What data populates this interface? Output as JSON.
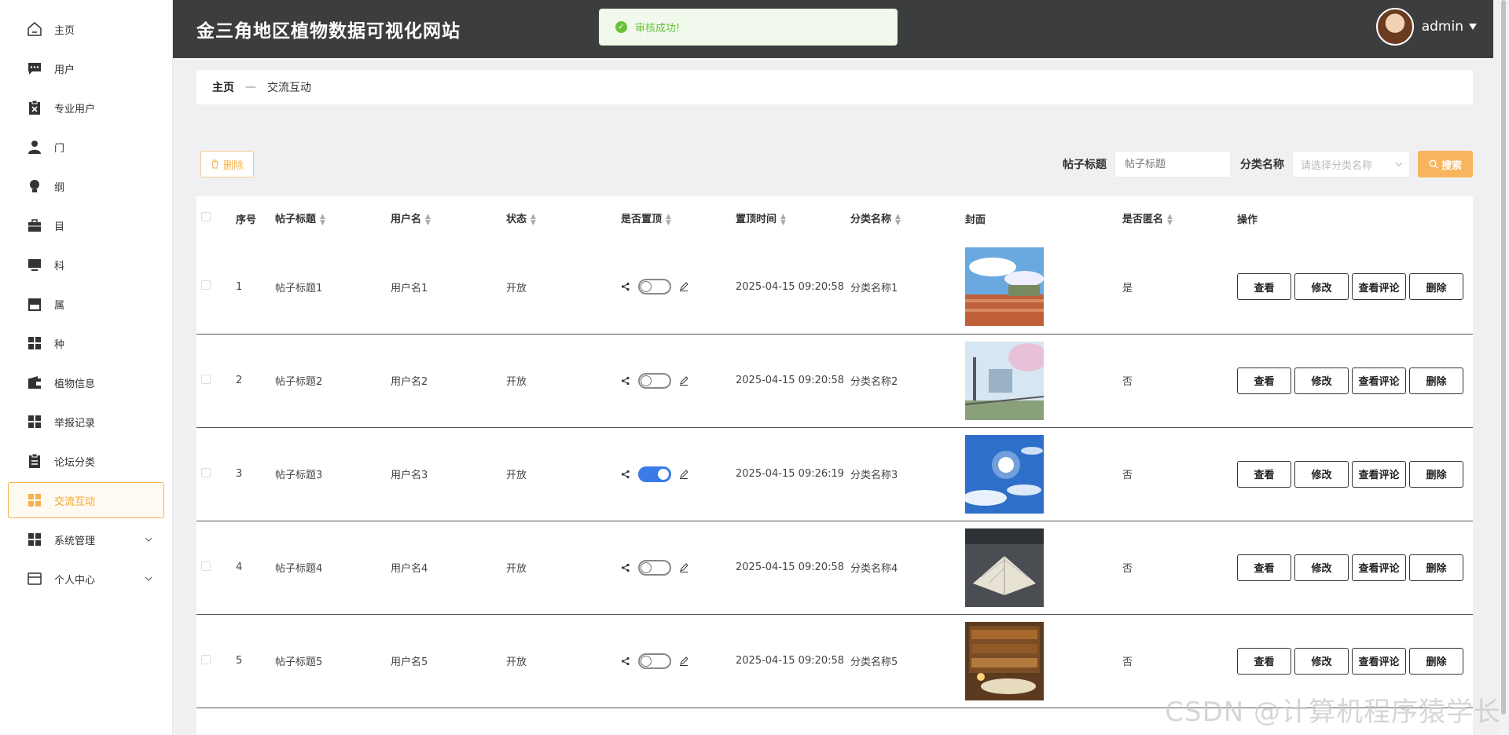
{
  "sidebar": {
    "items": [
      {
        "label": "主页",
        "icon": "home-icon"
      },
      {
        "label": "用户",
        "icon": "chat-icon"
      },
      {
        "label": "专业用户",
        "icon": "clipboard-x-icon"
      },
      {
        "label": "门",
        "icon": "person-icon"
      },
      {
        "label": "纲",
        "icon": "bulb-icon"
      },
      {
        "label": "目",
        "icon": "briefcase-icon"
      },
      {
        "label": "科",
        "icon": "monitor-icon"
      },
      {
        "label": "属",
        "icon": "store-icon"
      },
      {
        "label": "种",
        "icon": "grid-icon"
      },
      {
        "label": "植物信息",
        "icon": "wallet-icon"
      },
      {
        "label": "举报记录",
        "icon": "grid-icon"
      },
      {
        "label": "论坛分类",
        "icon": "clipboard-icon"
      },
      {
        "label": "交流互动",
        "icon": "grid-icon",
        "active": true
      },
      {
        "label": "系统管理",
        "icon": "grid-icon",
        "expandable": true
      },
      {
        "label": "个人中心",
        "icon": "card-icon",
        "expandable": true
      }
    ]
  },
  "header": {
    "title": "金三角地区植物数据可视化网站",
    "username": "admin"
  },
  "toast": {
    "message": "审核成功!"
  },
  "breadcrumb": {
    "home": "主页",
    "sep": "—",
    "current": "交流互动"
  },
  "toolbar": {
    "delete_label": "删除",
    "title_label": "帖子标题",
    "title_placeholder": "帖子标题",
    "category_label": "分类名称",
    "category_placeholder": "请选择分类名称",
    "search_label": "搜索"
  },
  "table": {
    "headers": [
      "序号",
      "帖子标题",
      "用户名",
      "状态",
      "是否置顶",
      "置顶时间",
      "分类名称",
      "封面",
      "是否匿名",
      "操作"
    ],
    "op_labels": [
      "查看",
      "修改",
      "查看评论",
      "删除"
    ],
    "rows": [
      {
        "no": "1",
        "title": "帖子标题1",
        "user": "用户名1",
        "status": "开放",
        "top": false,
        "time": "2025-04-15 09:20:58",
        "category": "分类名称1",
        "anon": "是",
        "cover": "stadium"
      },
      {
        "no": "2",
        "title": "帖子标题2",
        "user": "用户名2",
        "status": "开放",
        "top": false,
        "time": "2025-04-15 09:20:58",
        "category": "分类名称2",
        "anon": "否",
        "cover": "street"
      },
      {
        "no": "3",
        "title": "帖子标题3",
        "user": "用户名3",
        "status": "开放",
        "top": true,
        "time": "2025-04-15 09:26:19",
        "category": "分类名称3",
        "anon": "否",
        "cover": "sky"
      },
      {
        "no": "4",
        "title": "帖子标题4",
        "user": "用户名4",
        "status": "开放",
        "top": false,
        "time": "2025-04-15 09:20:58",
        "category": "分类名称4",
        "anon": "否",
        "cover": "book"
      },
      {
        "no": "5",
        "title": "帖子标题5",
        "user": "用户名5",
        "status": "开放",
        "top": false,
        "time": "2025-04-15 09:20:58",
        "category": "分类名称5",
        "anon": "否",
        "cover": "library"
      }
    ]
  },
  "watermark": "CSDN @计算机程序猿学长",
  "colors": {
    "accent": "#f5a623",
    "header_bg": "#3c3d3e",
    "success": "#67c23a",
    "switch_on": "#3a7be8"
  }
}
